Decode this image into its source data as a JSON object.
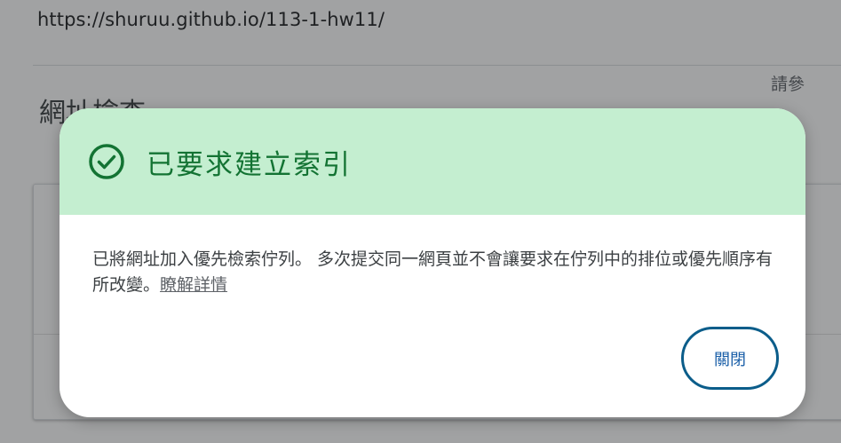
{
  "background": {
    "url": "https://shuruu.github.io/113-1-hw11/",
    "section_title": "網址檢查",
    "card_right_text": "請參"
  },
  "dialog": {
    "title": "已要求建立索引",
    "body_text": "已將網址加入優先檢索佇列。 多次提交同一網頁並不會讓要求在佇列中的排位或優先順序有所改變。",
    "learn_more": "瞭解詳情",
    "close_label": "關閉",
    "icon": "check-circle-icon",
    "colors": {
      "header_bg": "#c4eed0",
      "title": "#137333",
      "button_border": "#0b5d8a"
    }
  }
}
